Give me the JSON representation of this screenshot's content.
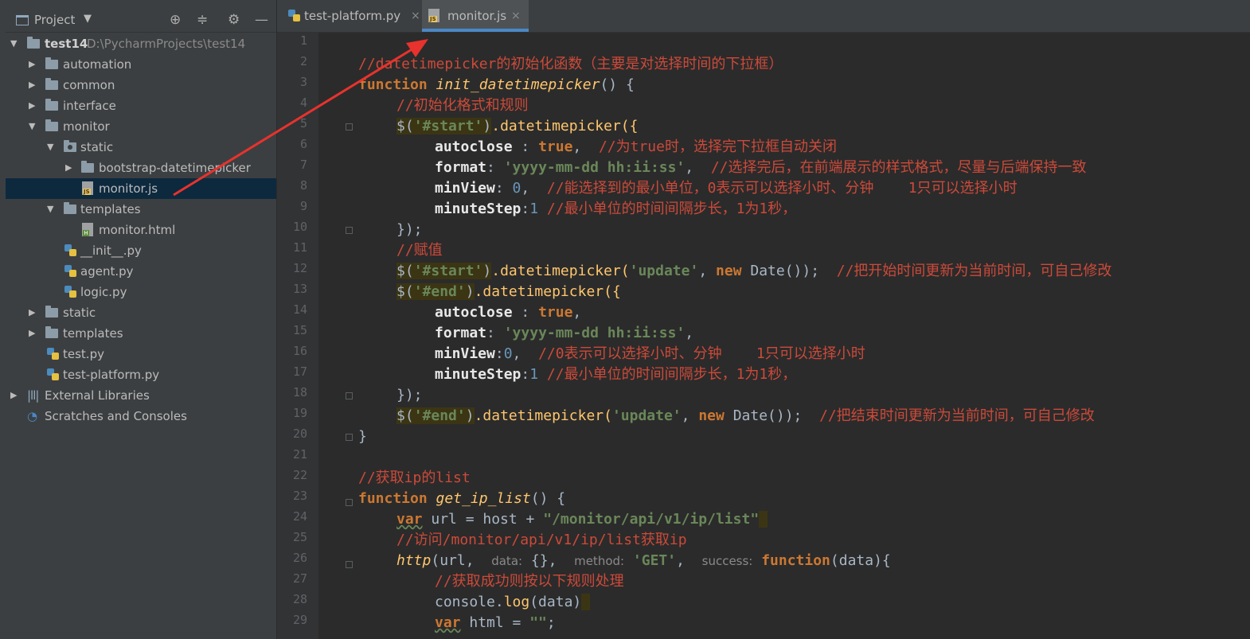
{
  "project_panel": {
    "title": "Project",
    "tree": [
      {
        "name": "test14",
        "path": "D:\\PycharmProjects\\test14",
        "type": "folder",
        "expanded": true
      },
      {
        "name": "automation",
        "type": "folder"
      },
      {
        "name": "common",
        "type": "folder"
      },
      {
        "name": "interface",
        "type": "folder"
      },
      {
        "name": "monitor",
        "type": "folder",
        "expanded": true
      },
      {
        "name": "static",
        "type": "folder",
        "expanded": true
      },
      {
        "name": "bootstrap-datetimepicker",
        "type": "folder"
      },
      {
        "name": "monitor.js",
        "type": "js",
        "selected": true
      },
      {
        "name": "templates",
        "type": "folder",
        "expanded": true
      },
      {
        "name": "monitor.html",
        "type": "html"
      },
      {
        "name": "__init__.py",
        "type": "py"
      },
      {
        "name": "agent.py",
        "type": "py"
      },
      {
        "name": "logic.py",
        "type": "py"
      },
      {
        "name": "static",
        "type": "folder"
      },
      {
        "name": "templates",
        "type": "folder"
      },
      {
        "name": "test.py",
        "type": "py"
      },
      {
        "name": "test-platform.py",
        "type": "py"
      },
      {
        "name": "External Libraries",
        "type": "lib"
      },
      {
        "name": "Scratches and Consoles",
        "type": "scratch"
      }
    ]
  },
  "tabs": [
    {
      "label": "test-platform.py",
      "active": false
    },
    {
      "label": "monitor.js",
      "active": true
    }
  ],
  "line_numbers": [
    "1",
    "2",
    "3",
    "4",
    "5",
    "6",
    "7",
    "8",
    "9",
    "10",
    "11",
    "12",
    "13",
    "14",
    "15",
    "16",
    "17",
    "18",
    "19",
    "20",
    "21",
    "22",
    "23",
    "24",
    "25",
    "26",
    "27",
    "28",
    "29"
  ],
  "code": {
    "l2": "//datetimepicker的初始化函数（主要是对选择时间的下拉框）",
    "l3_kw": "function",
    "l3_fn": "init_datetimepicker",
    "l3_rest": "() {",
    "l4": "//初始化格式和规则",
    "l5_a": "$(",
    "l5_s": "'#start'",
    "l5_b": ")",
    "l5_c": ".datetimepicker({",
    "l6_k": "autoclose",
    "l6_p": " : ",
    "l6_v": "true",
    "l6_c": ",  ",
    "l6_cm": "//为true时，选择完下拉框自动关闭",
    "l7_k": "format",
    "l7_p": ": ",
    "l7_v": "'yyyy-mm-dd hh:ii:ss'",
    "l7_c": ",  ",
    "l7_cm": "//选择完后，在前端展示的样式格式，尽量与后端保持一致",
    "l8_k": "minView",
    "l8_p": ": ",
    "l8_v": "0",
    "l8_c": ",  ",
    "l8_cm": "//能选择到的最小单位，0表示可以选择小时、分钟    1只可以选择小时",
    "l9_k": "minuteStep",
    "l9_p": ":",
    "l9_v": "1",
    "l9_cm": " //最小单位的时间间隔步长，1为1秒，",
    "l10": "});",
    "l11": "//赋值",
    "l12_a": "$(",
    "l12_s": "'#start'",
    "l12_b": ")",
    "l12_c": ".datetimepicker(",
    "l12_s2": "'update'",
    "l12_d": ", ",
    "l12_kw": "new",
    "l12_e": " Date());  ",
    "l12_cm": "//把开始时间更新为当前时间，可自己修改",
    "l13_a": "$(",
    "l13_s": "'#end'",
    "l13_b": ")",
    "l13_c": ".datetimepicker({",
    "l14_k": "autoclose",
    "l14_p": " : ",
    "l14_v": "true",
    "l14_c": ",",
    "l15_k": "format",
    "l15_p": ": ",
    "l15_v": "'yyyy-mm-dd hh:ii:ss'",
    "l15_c": ",",
    "l16_k": "minView",
    "l16_p": ":",
    "l16_v": "0",
    "l16_c": ",  ",
    "l16_cm": "//0表示可以选择小时、分钟    1只可以选择小时",
    "l17_k": "minuteStep",
    "l17_p": ":",
    "l17_v": "1",
    "l17_cm": " //最小单位的时间间隔步长，1为1秒，",
    "l18": "});",
    "l19_a": "$(",
    "l19_s": "'#end'",
    "l19_b": ")",
    "l19_c": ".datetimepicker(",
    "l19_s2": "'update'",
    "l19_d": ", ",
    "l19_kw": "new",
    "l19_e": " Date());  ",
    "l19_cm": "//把结束时间更新为当前时间，可自己修改",
    "l20": "}",
    "l22": "//获取ip的list",
    "l23_kw": "function",
    "l23_fn": "get_ip_list",
    "l23_rest": "() {",
    "l24_kw": "var",
    "l24_a": " url = host + ",
    "l24_s": "\"/monitor/api/v1/ip/list\"",
    "l25": "//访问/monitor/api/v1/ip/list获取ip",
    "l26_fn": "http",
    "l26_a": "(url,  ",
    "l26_h1": "data:",
    "l26_b": " {},  ",
    "l26_h2": "method:",
    "l26_s": " 'GET'",
    "l26_c": ",  ",
    "l26_h3": "success:",
    "l26_kw": " function",
    "l26_d": "(data){",
    "l27": "//获取成功则按以下规则处理",
    "l28_a": "console.",
    "l28_f": "log",
    "l28_b": "(data)",
    "l29_kw": "var",
    "l29_a": " html = ",
    "l29_s": "\"\"",
    "l29_b": ";"
  },
  "colors": {
    "background": "#2b2b2b",
    "panel": "#3c3f41",
    "keyword": "#cc7832",
    "comment": "#cc4a3a",
    "string": "#6a8759",
    "number": "#6897bb",
    "accent": "#4a88c7",
    "annotation_arrow": "#e8322d"
  }
}
